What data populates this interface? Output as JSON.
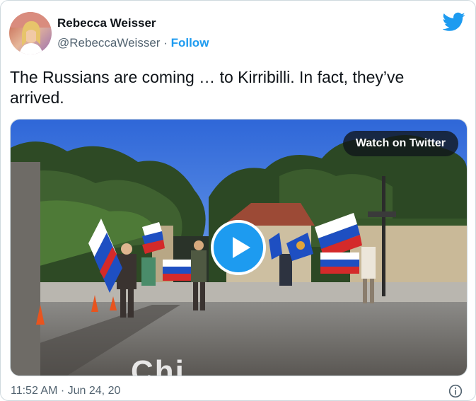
{
  "author": {
    "name": "Rebecca Weisser",
    "handle": "@RebeccaWeisser",
    "separator": "·",
    "follow_label": "Follow"
  },
  "tweet": {
    "text": "The Russians are coming … to Kirribilli. In fact, they’ve arrived."
  },
  "media": {
    "watch_label": "Watch on Twitter",
    "watermark": "Chi"
  },
  "footer": {
    "timestamp": "11:52 AM · Jun 24, 20"
  },
  "colors": {
    "twitter_blue": "#1d9bf0",
    "text": "#0f1419",
    "muted": "#536471",
    "border": "#cfd9de"
  },
  "icons": [
    "twitter-bird-icon",
    "play-icon",
    "info-icon"
  ]
}
